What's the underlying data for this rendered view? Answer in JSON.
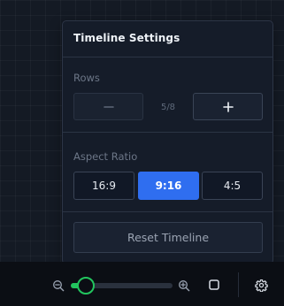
{
  "panel": {
    "title": "Timeline Settings",
    "rows": {
      "label": "Rows",
      "decrement_icon": "minus-icon",
      "value": "5/8",
      "increment_icon": "plus-icon"
    },
    "aspect_ratio": {
      "label": "Aspect Ratio",
      "options": [
        "16:9",
        "9:16",
        "4:5"
      ],
      "selected": "9:16"
    },
    "reset_label": "Reset Timeline"
  },
  "toolbar": {
    "zoom_out_icon": "zoom-out-icon",
    "zoom_in_icon": "zoom-in-icon",
    "zoom_level": 0.15,
    "frame_toggle_icon": "square-icon",
    "settings_icon": "gear-icon"
  },
  "colors": {
    "accent": "#2f6ef0",
    "slider": "#22c55e",
    "background": "#141a24",
    "panel": "#151c29"
  }
}
